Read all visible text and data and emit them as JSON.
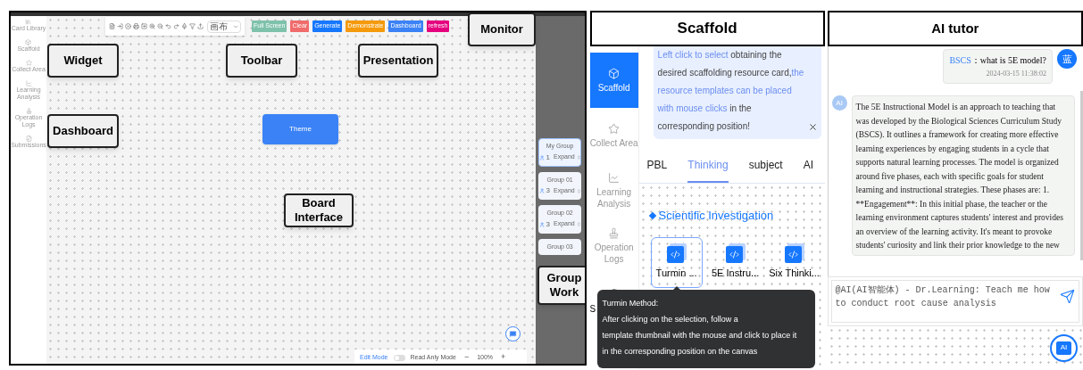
{
  "board": {
    "sidebar": [
      {
        "label": "Card Library",
        "kind": "library"
      },
      {
        "label": "Scaffold",
        "kind": "scaffold"
      },
      {
        "label": "Collect Area",
        "kind": "collect"
      },
      {
        "label": "Learning Analysis",
        "kind": "analysis"
      },
      {
        "label": "Operation Logs",
        "kind": "logs"
      },
      {
        "label": "Submissions",
        "kind": "submissions"
      }
    ],
    "toolbar": {
      "select_value": "画布"
    },
    "buttons": [
      {
        "label": "Full Screen",
        "color": "#7fc2ab"
      },
      {
        "label": "Clear",
        "color": "#f06b6b"
      },
      {
        "label": "Generate",
        "color": "#1677ff"
      },
      {
        "label": "Demonstrate",
        "color": "#f59a0b"
      },
      {
        "label": "Dashboard",
        "color": "#3b82f6"
      },
      {
        "label": "refresh",
        "color": "#e5007e"
      }
    ],
    "theme_button": "Theme",
    "callouts": [
      "Monitor",
      "Widget",
      "Toolbar",
      "Presentation",
      "Dashboard",
      "Board Interface",
      "Group Work"
    ],
    "groups": [
      {
        "name": "My Group",
        "members": "1",
        "action": "Expand",
        "selected": true
      },
      {
        "name": "Group 01",
        "members": "3",
        "action": "Expand",
        "selected": false
      },
      {
        "name": "Group 02",
        "members": "3",
        "action": "Expand",
        "selected": false
      },
      {
        "name": "Group 03",
        "selected": false
      }
    ],
    "modes": [
      {
        "label": "Edit Mode",
        "selected": true
      },
      {
        "label": "Read Anly Mode",
        "selected": false
      }
    ],
    "zoom": {
      "minus": "−",
      "value": "100%",
      "plus": "+"
    }
  },
  "scaffold": {
    "title": "Scaffold",
    "nav": [
      {
        "label": "Scaffold",
        "kind": "cube",
        "selected": true
      },
      {
        "label": "Collect Area",
        "kind": "star",
        "selected": false
      },
      {
        "label": "Learning Analysis",
        "kind": "chart",
        "selected": false
      },
      {
        "label": "Operation Logs",
        "kind": "stamp",
        "selected": false
      },
      {
        "label": "S",
        "kind": "clipboard",
        "selected": false
      }
    ],
    "info": [
      {
        "text": "Left click to select",
        "kind": "link"
      },
      {
        "text": " obtaining the desired scaffolding resource card,",
        "kind": "plain"
      },
      {
        "text": "the resource templates can be placed with mouse clicks",
        "kind": "link"
      },
      {
        "text": " in the corresponding position!",
        "kind": "plain"
      }
    ],
    "tabs": [
      {
        "label": "PBL",
        "selected": false
      },
      {
        "label": "Thinking",
        "selected": true
      },
      {
        "label": "subject",
        "selected": false
      },
      {
        "label": "AI",
        "selected": false
      }
    ],
    "section_title": "Scientific Investigation",
    "cards": [
      {
        "label": "Turmin ...",
        "selected": true
      },
      {
        "label": "5E Instru...",
        "selected": false
      },
      {
        "label": "Six Thinki...",
        "selected": false
      }
    ],
    "tooltip": {
      "title": "Turmin Method:",
      "lines": [
        "After clicking on the selection, follow a",
        "template thumbnail with the mouse and click to place it",
        "in the corresponding position on the canvas"
      ]
    }
  },
  "tutor": {
    "title": "AI tutor",
    "user_message": {
      "sender": "BSCS",
      "text": "：what is 5E model?",
      "time": "2024-03-15 11:38:02",
      "avatar": "蓝"
    },
    "ai_message": {
      "avatar": "AI",
      "text": "The 5E Instructional Model is an approach to teaching that was developed by the Biological Sciences Curriculum Study (BSCS). It outlines a framework for creating more effective learning experiences by engaging students in a cycle that supports natural learning processes. The model is organized around five phases, each with specific goals for student learning and instructional strategies. These phases are: 1. **Engagement**: In this initial phase, the teacher or the learning environment captures students' interest and provides an overview of the learning activity. It's meant to provoke students' curiosity and link their prior knowledge to the new"
    },
    "input": {
      "value": "@AI(AI智能体) - Dr.Learning: Teach me how to conduct root cause analysis"
    },
    "ai_button": "AI"
  }
}
